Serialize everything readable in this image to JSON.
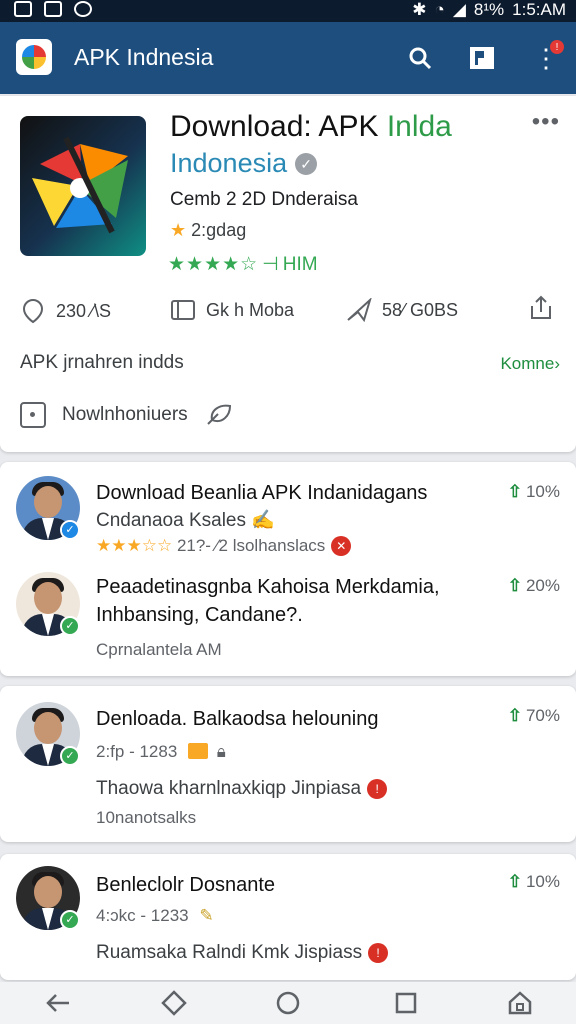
{
  "status_bar": {
    "battery": "8¹%",
    "time": "1:5:AM"
  },
  "app_bar": {
    "title": "APK Indnesia",
    "notification_count": "!"
  },
  "app": {
    "title_line1": "Download: APK",
    "title_line1_accent": "Inlda",
    "title_line2": "Indonesia",
    "developer": "Cemb 2 2D Dnderaisa",
    "rating_text": "2:gdag",
    "stars_text": "★★★★☆",
    "installs_tag": "HIM",
    "stats": [
      {
        "icon": "location-pin-icon",
        "label": "230 ⁄\\S"
      },
      {
        "icon": "book-icon",
        "label": "Gk h Moba"
      },
      {
        "icon": "send-icon",
        "label": "58⁄ G0BS"
      }
    ],
    "description": "APK jrnahren indds",
    "more_label": "Komne›",
    "bottom_label": "Nowlnhoniuers"
  },
  "feed": [
    {
      "title": "Download Beanlia APK Indanidagans",
      "subtitle": "Cndanaoa Ksales",
      "meta": "21?- ⁄2 lsolhanslacs",
      "stars": "★★★☆☆",
      "trend": "10%",
      "avatar_badge_color": "#1e88e5"
    },
    {
      "title": "Peaadetinasgnba Kahoisa Merkdamia,",
      "title_line2": "Inhbansing, Candane?.",
      "meta": "Cprnalantela AM",
      "trend": "20%",
      "avatar_badge_color": "#34a853"
    },
    {
      "title": "Denloada. Balkaodsa helouning",
      "meta": "2:fp - 1283",
      "subtitle": "Thaowa kharnlnaxkiqp Jinpiasa",
      "meta2": "10nanotsalks",
      "trend": "70%",
      "avatar_badge_color": "#34a853"
    },
    {
      "title": "Benleclolr Dosnante",
      "meta": "4:ɔkc - 1233",
      "subtitle": "Ruamsaka Ralndi Kmk Jispiass",
      "trend": "10%",
      "avatar_badge_color": "#34a853"
    }
  ],
  "colors": {
    "appbar": "#1d4e7e",
    "accent_green": "#1e8e3e",
    "accent_blue": "#2a8ab5"
  }
}
